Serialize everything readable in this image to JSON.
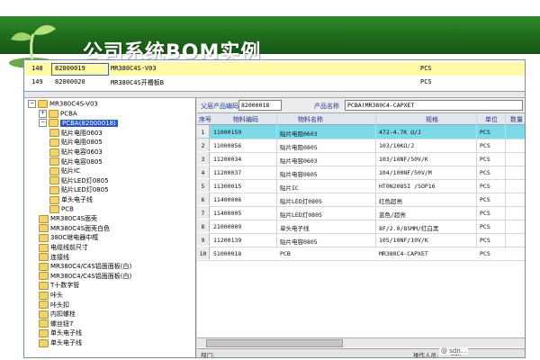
{
  "slide": {
    "title": "公司系统BOM实例",
    "watermark": "@ sdn..."
  },
  "top_grid": {
    "rows": [
      {
        "no": "148",
        "code": "82000019",
        "name": "MR380C4S-V03",
        "unit": "PCS",
        "selected": true
      },
      {
        "no": "149",
        "code": "82000020",
        "name": "MR380C4S开槽板B",
        "unit": "PCS",
        "selected": false
      }
    ]
  },
  "tree": {
    "nodes": [
      {
        "label": "MR380C4S-V03",
        "level": 0,
        "expander": "−"
      },
      {
        "label": "PCBA",
        "level": 1,
        "expander": "+"
      },
      {
        "label": "PCBA(82000018)",
        "level": 1,
        "expander": "−",
        "selected": true
      },
      {
        "label": "贴片电阻0603",
        "level": 2,
        "expander": ""
      },
      {
        "label": "贴片电阻0805",
        "level": 2,
        "expander": ""
      },
      {
        "label": "贴片电容0603",
        "level": 2,
        "expander": ""
      },
      {
        "label": "贴片电容0805",
        "level": 2,
        "expander": ""
      },
      {
        "label": "贴片IC",
        "level": 2,
        "expander": ""
      },
      {
        "label": "贴片LED灯0805",
        "level": 2,
        "expander": ""
      },
      {
        "label": "贴片LED灯0805",
        "level": 2,
        "expander": ""
      },
      {
        "label": "单头电子线",
        "level": 2,
        "expander": ""
      },
      {
        "label": "PCB",
        "level": 2,
        "expander": ""
      },
      {
        "label": "MR380C4S面壳",
        "level": 1,
        "expander": ""
      },
      {
        "label": "MR380C4S面壳白色",
        "level": 1,
        "expander": ""
      },
      {
        "label": "380C继电器中框",
        "level": 1,
        "expander": ""
      },
      {
        "label": "电缆线前尺寸",
        "level": 1,
        "expander": ""
      },
      {
        "label": "连接线",
        "level": 1,
        "expander": ""
      },
      {
        "label": "MR380C4/C4S铝面面板(白)",
        "level": 1,
        "expander": ""
      },
      {
        "label": "MR380C4/C4S铝面面板(白)",
        "level": 1,
        "expander": ""
      },
      {
        "label": "T十数字管",
        "level": 1,
        "expander": ""
      },
      {
        "label": "咔头",
        "level": 1,
        "expander": ""
      },
      {
        "label": "咔头扣",
        "level": 1,
        "expander": ""
      },
      {
        "label": "内扣螺栓",
        "level": 1,
        "expander": ""
      },
      {
        "label": "螺丝钮7",
        "level": 1,
        "expander": ""
      },
      {
        "label": "单头电子线",
        "level": 1,
        "expander": ""
      },
      {
        "label": "单头电子线",
        "level": 1,
        "expander": ""
      }
    ]
  },
  "field_bar": {
    "parent_code_label": "父层产品编码",
    "parent_code_value": "82000018",
    "product_name_label": "产品名称",
    "product_name_value": "PCBA(MR380C4-CAPXET"
  },
  "grid": {
    "headers": [
      "序号",
      "物料编码",
      "物料名称",
      "规格",
      "单位",
      "数量"
    ],
    "rows": [
      {
        "no": "1",
        "code": "11000159",
        "name": "贴片电阻0603",
        "spec": "472-4.7K Ω/J",
        "unit": "PCS",
        "selected": true
      },
      {
        "no": "2",
        "code": "11000056",
        "name": "贴片电阻0805",
        "spec": "103/10KΩ/J",
        "unit": "PCS",
        "selected": false
      },
      {
        "no": "3",
        "code": "11200034",
        "name": "贴片电容0603",
        "spec": "103/10NF/50V/K",
        "unit": "PCS",
        "selected": false
      },
      {
        "no": "4",
        "code": "11200037",
        "name": "贴片电容0805",
        "spec": "104/100NF/50V/M",
        "unit": "PCS",
        "selected": false
      },
      {
        "no": "5",
        "code": "11300015",
        "name": "贴片IC",
        "spec": "HT0N208SI /SOP16",
        "unit": "PCS",
        "selected": false
      },
      {
        "no": "6",
        "code": "11400006",
        "name": "贴片LED灯0805",
        "spec": "红色超亮",
        "unit": "PCS",
        "selected": false
      },
      {
        "no": "7",
        "code": "11400005",
        "name": "贴片LED灯0805",
        "spec": "蓝色/超亮",
        "unit": "PCS",
        "selected": false
      },
      {
        "no": "8",
        "code": "21000009",
        "name": "单头电子线",
        "spec": "8F/2.0/85MM/红白黑",
        "unit": "PCS",
        "selected": false
      },
      {
        "no": "9",
        "code": "11200139",
        "name": "贴片电容0805",
        "spec": "105/10NF/10V/K",
        "unit": "PCS",
        "selected": false
      },
      {
        "no": "10",
        "code": "51000018",
        "name": "PCB",
        "spec": "MR380C4-CAPXET",
        "unit": "PCS",
        "selected": false
      }
    ]
  },
  "status_bar": {
    "left_label": "部门:",
    "right_label": "操作人员:",
    "right_value": "sdn"
  },
  "colors": {
    "banner": "#1f6a1c",
    "selected_top_row": "#fff9a8",
    "selected_grid_row": "#7cd9e8",
    "selected_tree_node": "#2a56c6"
  }
}
